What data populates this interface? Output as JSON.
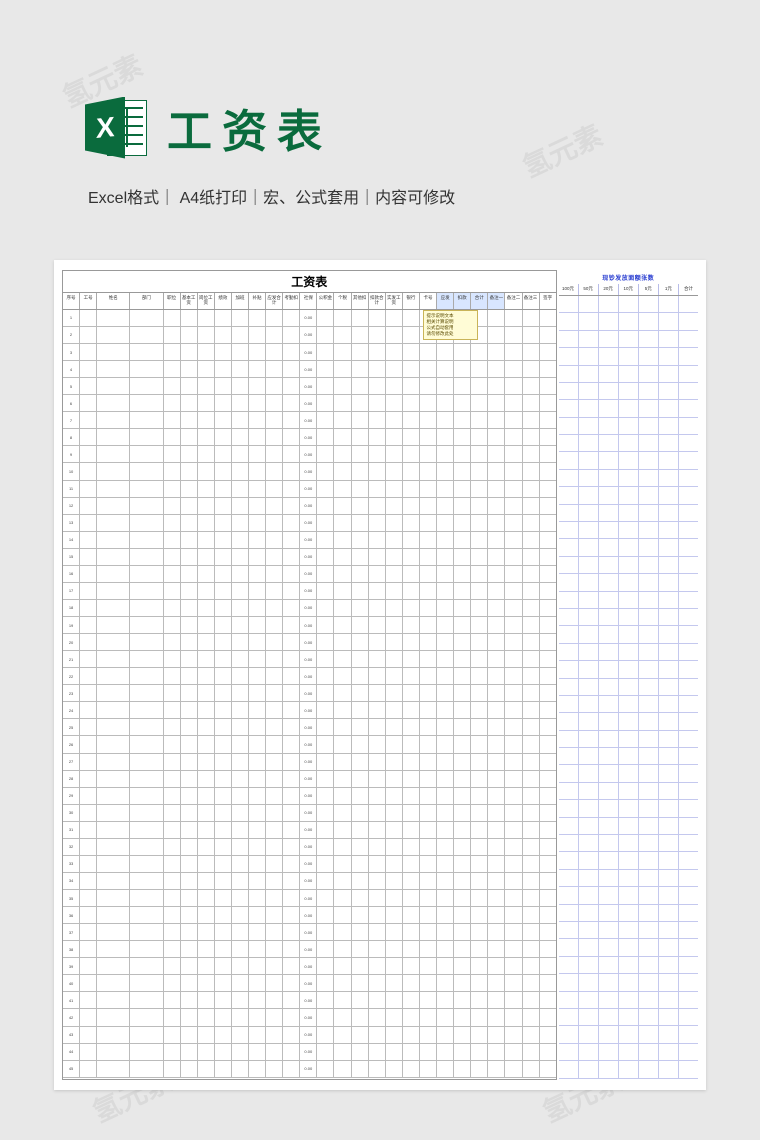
{
  "watermark_text": "氢元素",
  "header": {
    "icon_letter": "X",
    "title": "工资表",
    "subtitle": "Excel格式｜ A4纸打印｜宏、公式套用｜内容可修改"
  },
  "main_table": {
    "title": "工资表",
    "columns": [
      "序号",
      "工号",
      "姓名",
      "部门",
      "职位",
      "基本工资",
      "岗位工资",
      "绩效",
      "加班",
      "补贴",
      "应发合计",
      "考勤扣",
      "社保",
      "公积金",
      "个税",
      "其他扣",
      "扣款合计",
      "实发工资",
      "银行",
      "卡号",
      "应发",
      "扣款",
      "合计",
      "备注一",
      "备注二",
      "备注三",
      "签字"
    ],
    "row_count": 45,
    "row_label_prefix": "",
    "center_label": "0.00",
    "tooltip_lines": [
      "提示说明文本",
      "相关计算说明",
      "公式自动套用",
      "请勿修改此处"
    ],
    "highlight_header_start": 20,
    "highlight_header_end": 23
  },
  "side_table": {
    "title": "现钞发放面额张数",
    "columns": [
      "100元",
      "50元",
      "20元",
      "10元",
      "5元",
      "1元",
      "合计"
    ],
    "row_count": 45
  }
}
